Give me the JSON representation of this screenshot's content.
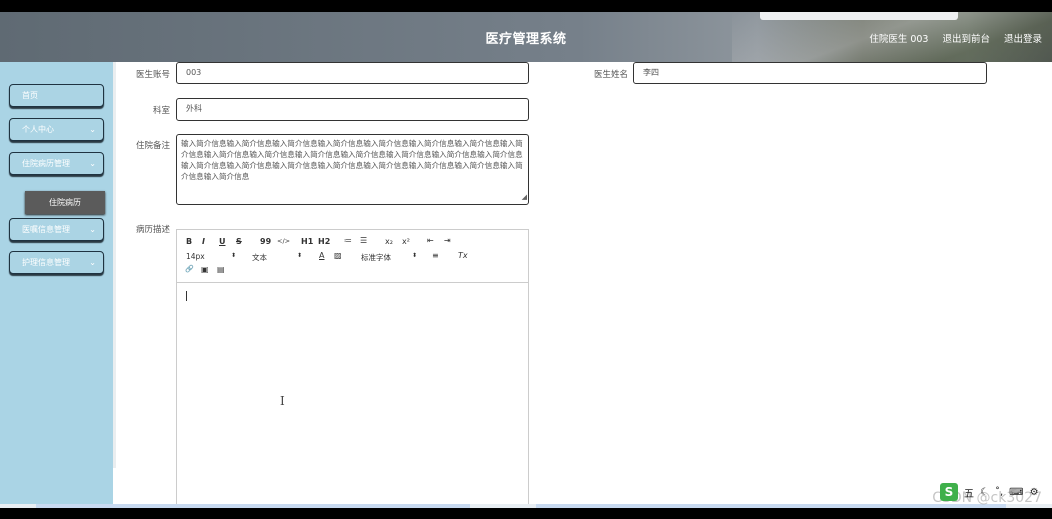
{
  "header": {
    "title": "医疗管理系统",
    "user_label": "住院医生 003",
    "back_link": "退出到前台",
    "logout_link": "退出登录"
  },
  "sidebar": {
    "items": [
      {
        "label": "首页"
      },
      {
        "label": "个人中心",
        "chevron": "⌄"
      },
      {
        "label": "住院病历管理",
        "chevron": "⌄"
      },
      {
        "label": "医嘱信息管理",
        "chevron": "⌄"
      },
      {
        "label": "护理信息管理",
        "chevron": "⌄"
      }
    ],
    "sub_item": "住院病历"
  },
  "form": {
    "doctor_id_label": "医生账号",
    "doctor_id_value": "003",
    "doctor_name_label": "医生姓名",
    "doctor_name_value": "李四",
    "department_label": "科室",
    "department_value": "外科",
    "remarks_label": "住院备注",
    "remarks_value": "输入简介信息输入简介信息输入简介信息输入简介信息输入简介信息输入简介信息输入简介信息输入简介信息输入简介信息输入简介信息输入简介信息输入简介信息输入简介信息输入简介信息输入简介信息输入简介信息输入简介信息输入简介信息输入简介信息输入简介信息输入简介信息输入简介信息输入简介信息输入简介信息",
    "description_label": "病历描述"
  },
  "editor": {
    "bold": "B",
    "italic": "I",
    "underline": "U",
    "strike": "S",
    "quote": "99",
    "code": "</>",
    "h1": "H1",
    "h2": "H2",
    "ordered_list": "≔",
    "bullet_list": "☰",
    "subscript": "x₂",
    "superscript": "x²",
    "outdent": "⇤",
    "indent": "⇥",
    "font_size": "14px",
    "text_style": "文本",
    "font_color": "A",
    "bg_color": "▨",
    "font_family": "标准字体",
    "align": "≡",
    "clear_format": "Tx",
    "link": "🔗",
    "image": "▣",
    "video": "▤"
  },
  "watermark": "CSDN @ck3027",
  "ime": {
    "logo": "S",
    "mode": "五"
  }
}
